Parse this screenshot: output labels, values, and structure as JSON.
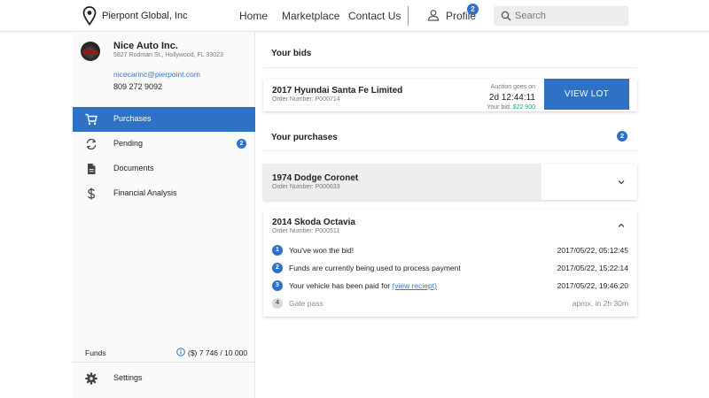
{
  "header": {
    "brand": "Pierpont Global, Inc",
    "nav": [
      {
        "label": "Home"
      },
      {
        "label": "Marketplace"
      },
      {
        "label": "Contact Us"
      }
    ],
    "profile": {
      "label": "Profile",
      "badge": "2"
    },
    "search": {
      "placeholder": "Search",
      "value": ""
    }
  },
  "sidebar": {
    "company": {
      "name": "Nice Auto Inc.",
      "address": "5827 Rodman St., Hollywood, FL 33023",
      "email": "nicecarinc@pierpoint.com",
      "phone": "809 272 9092"
    },
    "items": [
      {
        "label": "Purchases",
        "icon": "cart-icon",
        "active": true
      },
      {
        "label": "Pending",
        "icon": "sync-icon",
        "badge": "2"
      },
      {
        "label": "Documents",
        "icon": "document-icon"
      },
      {
        "label": "Financial Analysis",
        "icon": "dollar-icon"
      }
    ],
    "funds": {
      "label": "Funds",
      "value": "($) 7 746 / 10 000"
    },
    "settings": {
      "label": "Settings",
      "icon": "gear-icon"
    }
  },
  "bids": {
    "title": "Your bids",
    "items": [
      {
        "title": "2017 Hyundai Santa Fe Limited",
        "order": "Order Number: P000714",
        "auction_label": "Auction goes on",
        "countdown": "2d 12:44:11",
        "your_bid_label": "Your bid:",
        "your_bid_value": "$22 900",
        "button": "VIEW LOT"
      }
    ]
  },
  "purchases": {
    "title": "Your purchases",
    "count": "2",
    "items": [
      {
        "title": "1974 Dodge Coronet",
        "order": "Order Number: P000633",
        "expanded": false
      },
      {
        "title": "2014 Skoda Octavia",
        "order": "Order Number: P000511",
        "expanded": true,
        "steps": [
          {
            "num": "1",
            "text": "You've won the bid!",
            "time": "2017/05/22, 05:12:45",
            "done": true
          },
          {
            "num": "2",
            "text": "Funds are currently being used to process payment",
            "time": "2017/05/22, 15:22:14",
            "done": true
          },
          {
            "num": "3",
            "text": "Your vehicle has been paid for ",
            "link": "(view reciept)",
            "time": "2017/05/22, 19:46:20",
            "done": true
          },
          {
            "num": "4",
            "text": "Gate pass",
            "time": "aprox. in 2h 30m",
            "done": false
          }
        ]
      }
    ]
  },
  "colors": {
    "accent": "#2f71c4",
    "success": "#2ca56a",
    "link": "#3a75bf"
  }
}
